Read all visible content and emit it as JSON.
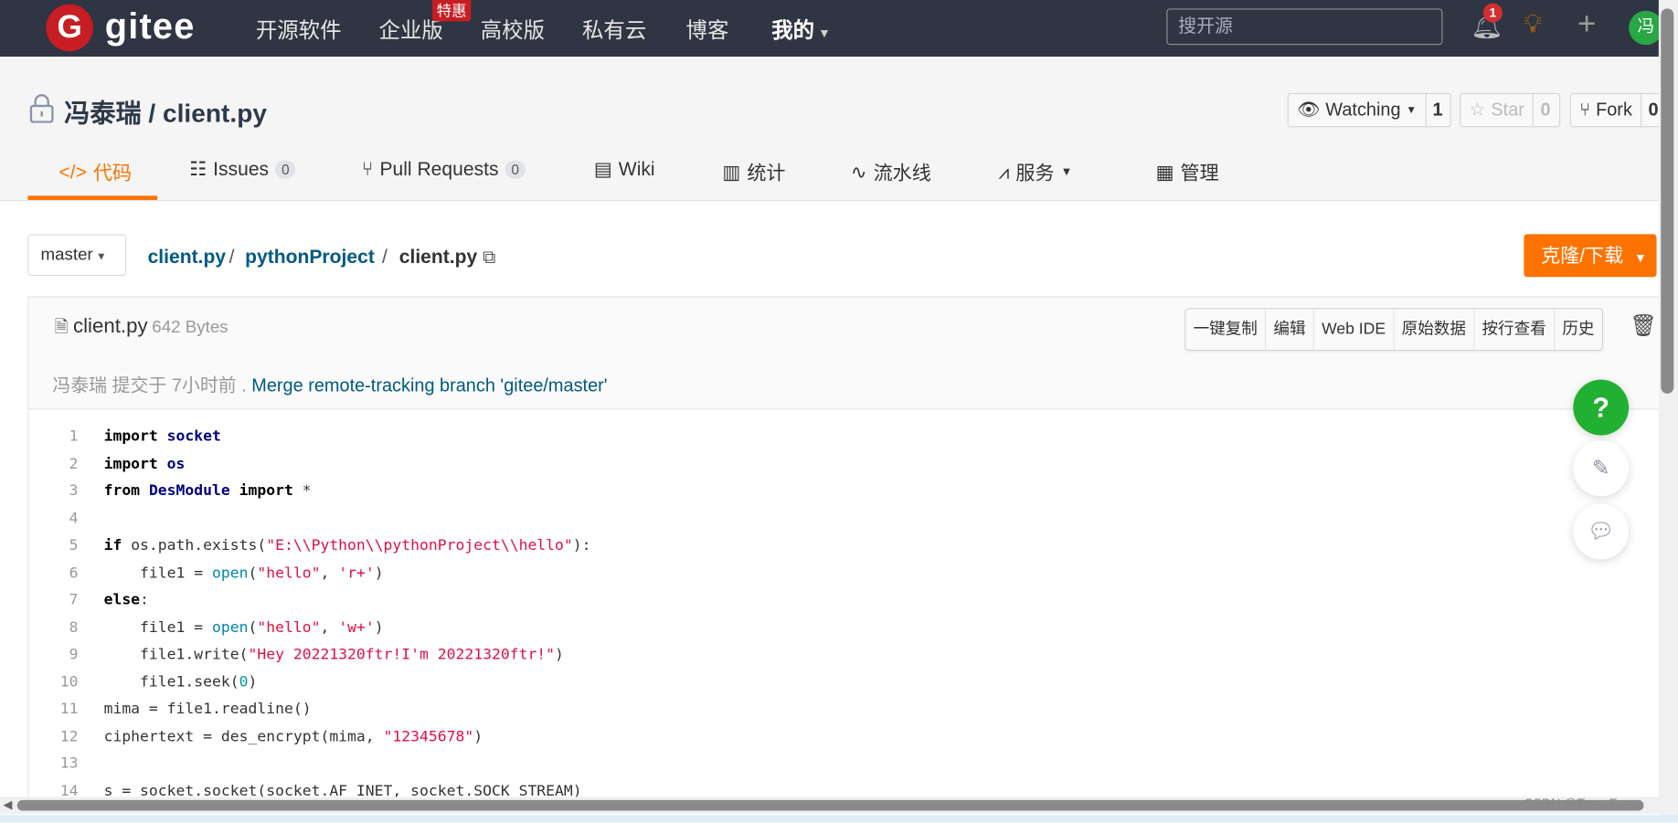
{
  "navbar": {
    "logo_letter": "G",
    "logo_text": "gitee",
    "items": [
      "开源软件",
      "企业版",
      "高校版",
      "私有云",
      "博客",
      "我的"
    ],
    "hot_badge": "特惠",
    "search_placeholder": "搜开源",
    "notification_count": "1",
    "avatar_text": "冯",
    "bg_color": "#2f3542"
  },
  "repo": {
    "title": "冯泰瑞 / client.py",
    "watching_label": "Watching",
    "watching_count": "1",
    "star_label": "Star",
    "star_count": "0",
    "fork_label": "Fork",
    "fork_count": "0"
  },
  "tabs": [
    {
      "icon": "</>",
      "label": "代码"
    },
    {
      "icon": "☷",
      "label": "Issues",
      "count": "0"
    },
    {
      "icon": "⑂",
      "label": "Pull Requests",
      "count": "0"
    },
    {
      "icon": "▤",
      "label": "Wiki"
    },
    {
      "icon": "▥",
      "label": "统计"
    },
    {
      "icon": "∿",
      "label": "流水线"
    },
    {
      "icon": "⩘",
      "label": "服务"
    },
    {
      "icon": "▦",
      "label": "管理"
    }
  ],
  "accent_color": "#fe7300",
  "toolbar": {
    "branch": "master",
    "breadcrumb": [
      "client.py",
      "pythonProject",
      "client.py"
    ],
    "clone_label": "克隆/下载"
  },
  "file": {
    "name": "client.py",
    "size": "642 Bytes",
    "actions": [
      "一键复制",
      "编辑",
      "Web IDE",
      "原始数据",
      "按行查看",
      "历史"
    ],
    "commit_author": "冯泰瑞",
    "commit_time": "提交于 7小时前 .",
    "commit_message": "Merge remote-tracking branch 'gitee/master'"
  },
  "code_lines": [
    [
      [
        "import",
        "kw"
      ],
      [
        " ",
        ""
      ],
      [
        "socket",
        "mod"
      ]
    ],
    [
      [
        "import",
        "kw"
      ],
      [
        " ",
        ""
      ],
      [
        "os",
        "mod"
      ]
    ],
    [
      [
        "from",
        "kw"
      ],
      [
        " ",
        ""
      ],
      [
        "DesModule",
        "mod"
      ],
      [
        " ",
        ""
      ],
      [
        "import",
        "kw"
      ],
      [
        " *",
        ""
      ]
    ],
    [],
    [
      [
        "if",
        "kw"
      ],
      [
        " os.path.exists(",
        ""
      ],
      [
        "\"E:\\\\Python\\\\pythonProject\\\\hello\"",
        "str"
      ],
      [
        "):",
        ""
      ]
    ],
    [
      [
        "    file1 = ",
        ""
      ],
      [
        "open",
        "bi"
      ],
      [
        "(",
        ""
      ],
      [
        "\"hello\"",
        "str"
      ],
      [
        ", ",
        ""
      ],
      [
        "'r+'",
        "str"
      ],
      [
        ")",
        ""
      ]
    ],
    [
      [
        "else",
        "kw"
      ],
      [
        ":",
        ""
      ]
    ],
    [
      [
        "    file1 = ",
        ""
      ],
      [
        "open",
        "bi"
      ],
      [
        "(",
        ""
      ],
      [
        "\"hello\"",
        "str"
      ],
      [
        ", ",
        ""
      ],
      [
        "'w+'",
        "str"
      ],
      [
        ")",
        ""
      ]
    ],
    [
      [
        "    file1.write(",
        ""
      ],
      [
        "\"Hey 20221320ftr!I'm 20221320ftr!\"",
        "str"
      ],
      [
        ")",
        ""
      ]
    ],
    [
      [
        "    file1.seek(",
        ""
      ],
      [
        "0",
        "num"
      ],
      [
        ")",
        ""
      ]
    ],
    [
      [
        "mima = file1.readline()",
        ""
      ]
    ],
    [
      [
        "ciphertext = des_encrypt(mima, ",
        ""
      ],
      [
        "\"12345678\"",
        "str"
      ],
      [
        ")",
        ""
      ]
    ],
    [],
    [
      [
        "s = socket.socket(socket.AF_INET, socket.SOCK_STREAM)",
        ""
      ]
    ]
  ],
  "floating": {
    "help": "?"
  },
  "watermark": "CSDN @Terry Feng"
}
